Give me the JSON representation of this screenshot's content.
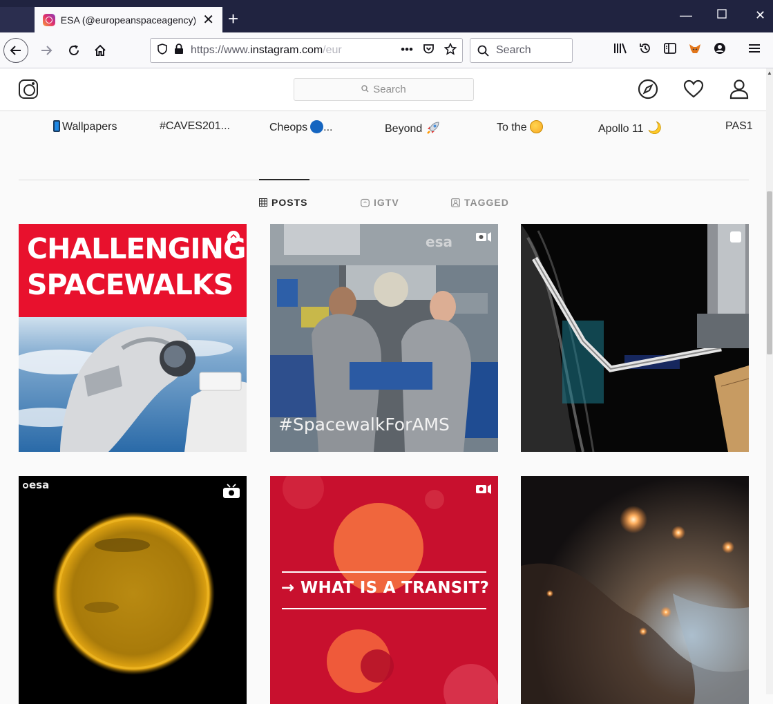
{
  "browser": {
    "tab_title": "ESA (@europeanspaceagency)",
    "url_prefix": "https://www.",
    "url_domain": "instagram.com",
    "url_rest": "/eur",
    "search_placeholder": "Search"
  },
  "instagram": {
    "search_placeholder": "Search"
  },
  "highlights": [
    "Wallpapers",
    "#CAVES201...",
    "Cheops",
    "...",
    "Beyond",
    "To the",
    "Apollo 11",
    "PAS1"
  ],
  "tabs": {
    "posts": "POSTS",
    "igtv": "IGTV",
    "tagged": "TAGGED"
  },
  "posts": {
    "post1_line1": "CHALLENGING",
    "post1_line2": "SPACEWALKS",
    "post2_caption": "#SpacewalkForAMS",
    "post2_watermark": "esa",
    "post4_watermark": "esa",
    "post5_text": "→ WHAT IS A TRANSIT?"
  },
  "colors": {
    "esa_red": "#e8112d",
    "transit_red": "#c8102e",
    "ig_text": "#262626",
    "browser_dark": "#202340"
  }
}
